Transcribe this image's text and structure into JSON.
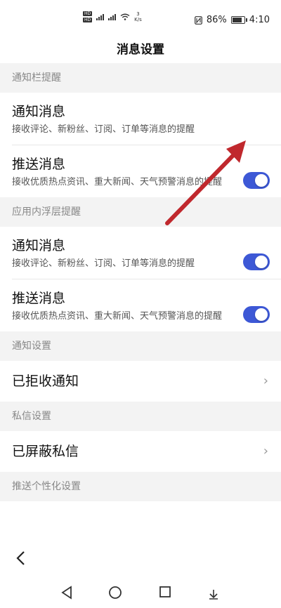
{
  "status_bar": {
    "network_speed": "3",
    "network_unit": "K/s",
    "battery_percent": "86%",
    "battery_level": 0.86,
    "time": "4:10",
    "hd_badge": "HD"
  },
  "header": {
    "title": "消息设置"
  },
  "sections": {
    "notification_bar": {
      "header": "通知栏提醒",
      "items": [
        {
          "title": "通知消息",
          "desc": "接收评论、新粉丝、订阅、订单等消息的提醒",
          "enabled": false
        },
        {
          "title": "推送消息",
          "desc": "接收优质热点资讯、重大新闻、天气预警消息的提醒",
          "enabled": true
        }
      ]
    },
    "in_app_float": {
      "header": "应用内浮层提醒",
      "items": [
        {
          "title": "通知消息",
          "desc": "接收评论、新粉丝、订阅、订单等消息的提醒",
          "enabled": true
        },
        {
          "title": "推送消息",
          "desc": "接收优质热点资讯、重大新闻、天气预警消息的提醒",
          "enabled": true
        }
      ]
    },
    "notification_settings": {
      "header": "通知设置",
      "link": "已拒收通知"
    },
    "private_message": {
      "header": "私信设置",
      "link": "已屏蔽私信"
    },
    "personalized_push": {
      "header": "推送个性化设置"
    }
  },
  "nav": {
    "back_icon": "chevron-left-icon"
  },
  "colors": {
    "toggle_on": "#3d58d6",
    "annotation_arrow": "#c0282d"
  }
}
